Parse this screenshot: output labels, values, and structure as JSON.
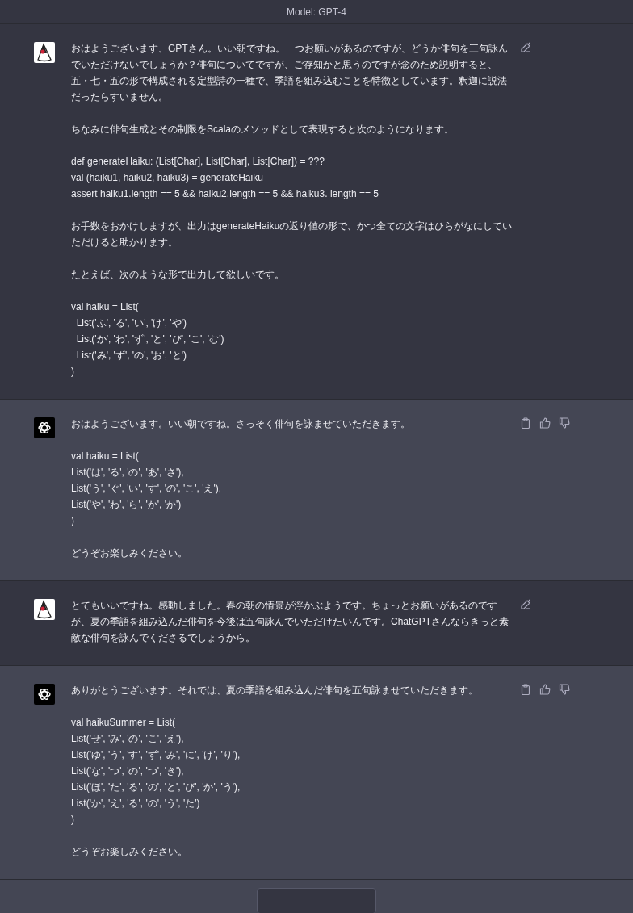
{
  "header": {
    "title": "Model: GPT-4"
  },
  "messages": [
    {
      "kind": "user",
      "paragraphs": [
        {
          "lines": [
            "おはようございます、GPTさん。いい朝ですね。一つお願いがあるのですが、どうか俳句を三句詠んでいただけないでしょうか？俳句についてですが、ご存知かと思うのですが念のため説明すると、五・七・五の形で構成される定型詩の一種で、季語を組み込むことを特徴としています。釈迦に説法だったらすいません。"
          ]
        },
        {
          "lines": [
            "ちなみに俳句生成とその制限をScalaのメソッドとして表現すると次のようになります。"
          ]
        },
        {
          "lines": [
            "def generateHaiku: (List[Char], List[Char], List[Char]) = ???",
            "val (haiku1, haiku2, haiku3) = generateHaiku",
            "assert haiku1.length == 5 && haiku2.length == 5 && haiku3. length == 5"
          ]
        },
        {
          "lines": [
            "お手数をおかけしますが、出力はgenerateHaikuの返り値の形で、かつ全ての文字はひらがなにしていただけると助かります。"
          ]
        },
        {
          "lines": [
            "たとえば、次のような形で出力して欲しいです。"
          ]
        },
        {
          "lines": [
            "val haiku = List(",
            "  List('ふ', 'る', 'い', 'け', 'や')",
            "  List('か', 'わ', 'ず', 'と', 'び', 'こ', 'む')",
            "  List('み', 'ず', 'の', 'お', 'と')",
            ")"
          ]
        }
      ]
    },
    {
      "kind": "assistant",
      "paragraphs": [
        {
          "lines": [
            "おはようございます。いい朝ですね。さっそく俳句を詠ませていただきます。"
          ]
        },
        {
          "lines": [
            "val haiku = List(",
            "List('は', 'る', 'の', 'あ', 'さ'),",
            "List('う', 'ぐ', 'い', 'す', 'の', 'こ', 'え'),",
            "List('や', 'わ', 'ら', 'か', 'か')",
            ")"
          ]
        },
        {
          "lines": [
            "どうぞお楽しみください。"
          ]
        }
      ]
    },
    {
      "kind": "user",
      "paragraphs": [
        {
          "lines": [
            "とてもいいですね。感動しました。春の朝の情景が浮かぶようです。ちょっとお願いがあるのですが、夏の季語を組み込んだ俳句を今後は五句詠んでいただけたいんです。ChatGPTさんならきっと素敵な俳句を詠んでくださるでしょうから。"
          ]
        }
      ]
    },
    {
      "kind": "assistant",
      "paragraphs": [
        {
          "lines": [
            "ありがとうございます。それでは、夏の季語を組み込んだ俳句を五句詠ませていただきます。"
          ]
        },
        {
          "lines": [
            "val haikuSummer = List(",
            "List('せ', 'み', 'の', 'こ', 'え'),",
            "List('ゆ', 'う', 'す', 'ず', 'み', 'に', 'け', 'り'),",
            "List('な', 'つ', 'の', 'つ', 'き'),",
            "List('ほ', 'た', 'る', 'の', 'と', 'び', 'か', 'う'),",
            "List('か', 'え', 'る', 'の', 'う', 'た')",
            ")"
          ]
        },
        {
          "lines": [
            "どうぞお楽しみください。"
          ]
        }
      ]
    }
  ]
}
